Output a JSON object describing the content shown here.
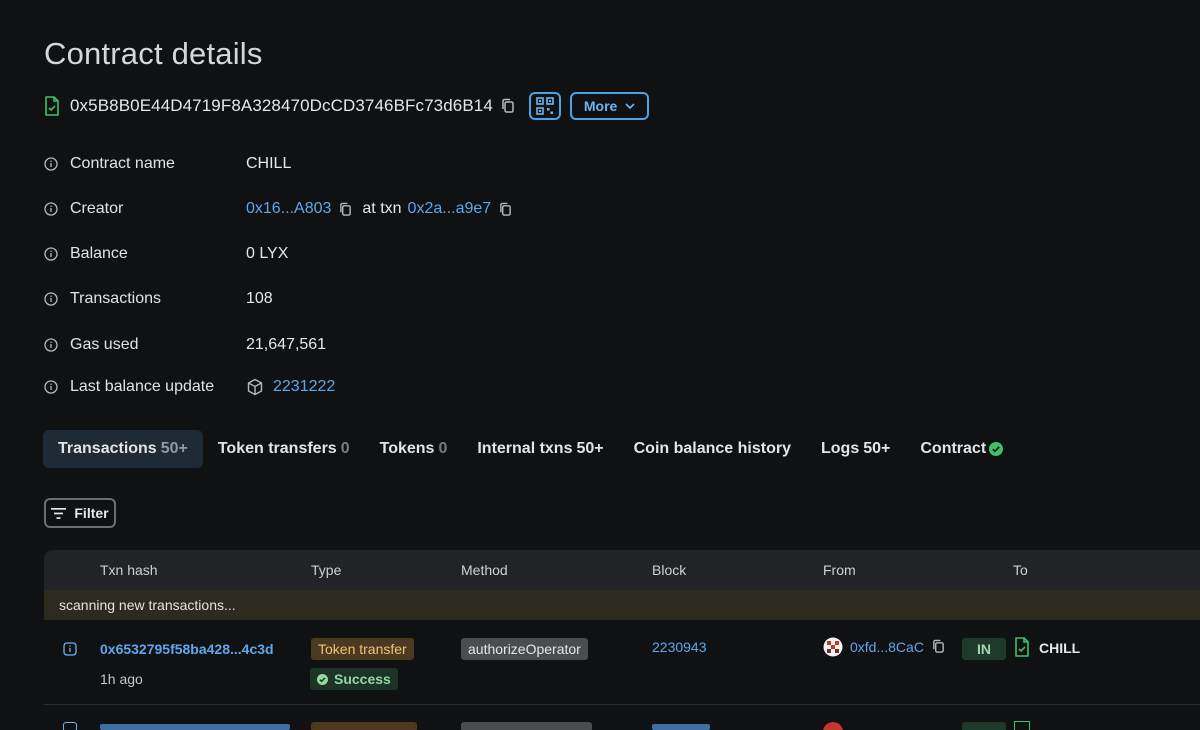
{
  "page": {
    "title": "Contract details",
    "address": "0x5B8B0E44D4719F8A328470DcCD3746BFc73d6B14",
    "more_label": "More"
  },
  "details": {
    "contract_name_label": "Contract name",
    "contract_name": "CHILL",
    "creator_label": "Creator",
    "creator_address": "0x16...A803",
    "at_txn_label": "at txn",
    "creator_txn": "0x2a...a9e7",
    "balance_label": "Balance",
    "balance": "0 LYX",
    "transactions_label": "Transactions",
    "transactions": "108",
    "gas_used_label": "Gas used",
    "gas_used": "21,647,561",
    "last_balance_update_label": "Last balance update",
    "last_balance_update_block": "2231222"
  },
  "tabs": [
    {
      "label": "Transactions",
      "count": "50+",
      "active": true
    },
    {
      "label": "Token transfers",
      "count": "0"
    },
    {
      "label": "Tokens",
      "count": "0"
    },
    {
      "label": "Internal txns",
      "count": "50+"
    },
    {
      "label": "Coin balance history",
      "count": ""
    },
    {
      "label": "Logs",
      "count": "50+"
    },
    {
      "label": "Contract",
      "count": ""
    }
  ],
  "filter_label": "Filter",
  "table": {
    "headers": [
      "Txn hash",
      "Type",
      "Method",
      "Block",
      "From",
      "To"
    ],
    "scanning_text": "scanning new transactions...",
    "rows": [
      {
        "hash": "0x6532795f58ba428...4c3d",
        "age": "1h ago",
        "type": "Token transfer",
        "status": "Success",
        "method": "authorizeOperator",
        "block": "2230943",
        "from": "0xfd...8CaC",
        "direction": "IN",
        "to": "CHILL"
      }
    ]
  },
  "colors": {
    "background": "#101112",
    "link": "#5ea7ef",
    "accent_border": "#4aa3e8",
    "success": "#3fbf6b"
  }
}
